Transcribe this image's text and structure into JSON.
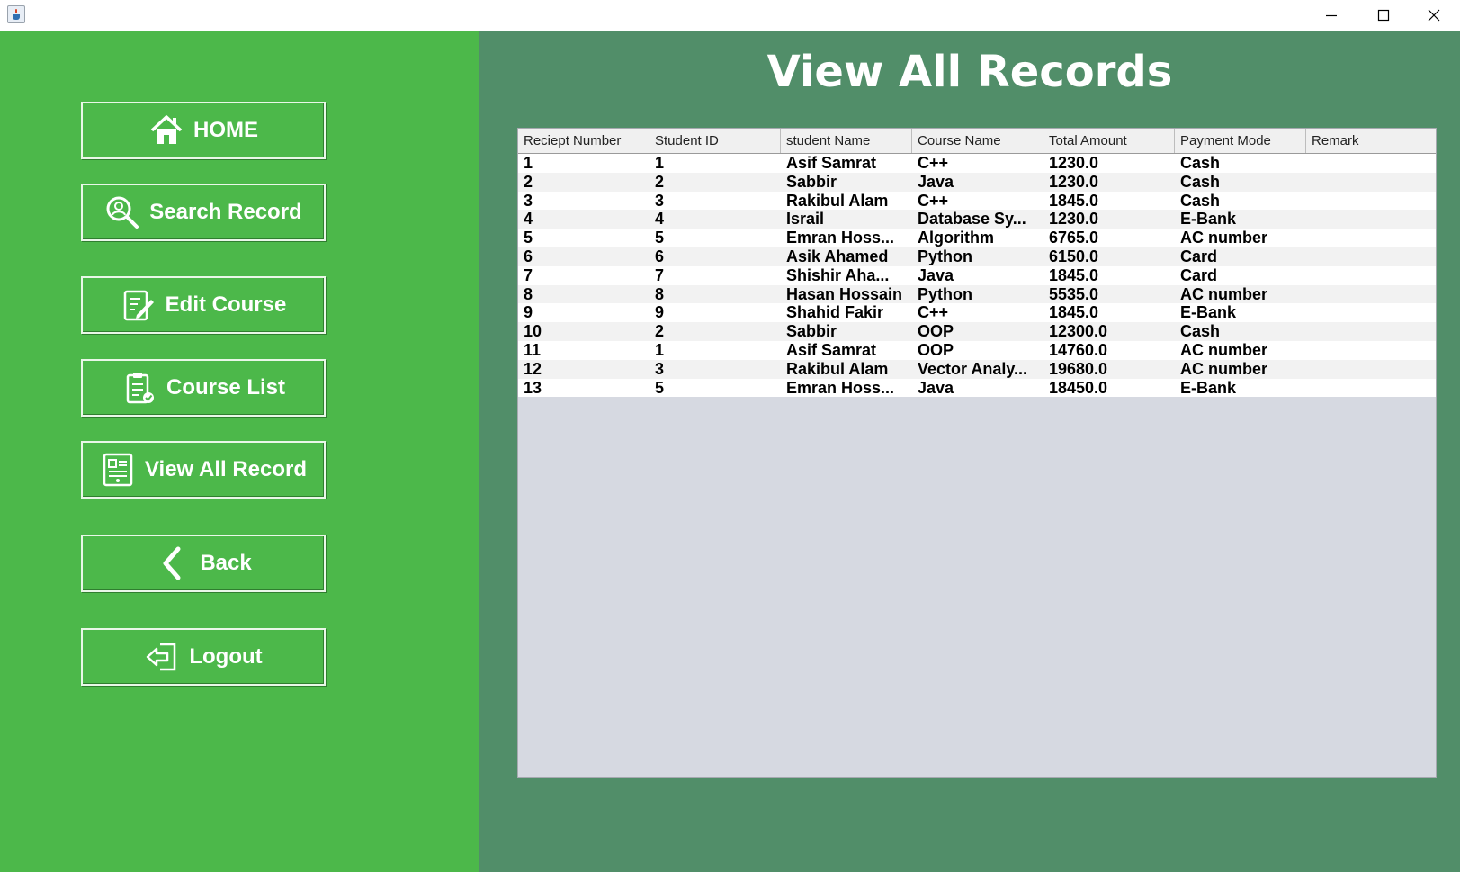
{
  "window": {
    "controls": [
      "minimize",
      "maximize",
      "close"
    ]
  },
  "sidebar": {
    "buttons": [
      {
        "label": "HOME",
        "icon": "home-icon"
      },
      {
        "label": "Search Record",
        "icon": "search-user-icon"
      },
      {
        "label": "Edit Course",
        "icon": "edit-document-icon"
      },
      {
        "label": "Course List",
        "icon": "checklist-icon"
      },
      {
        "label": "View All Record",
        "icon": "record-list-icon"
      },
      {
        "label": "Back",
        "icon": "chevron-left-icon"
      },
      {
        "label": "Logout",
        "icon": "logout-icon"
      }
    ]
  },
  "main": {
    "title": "View All Records",
    "table": {
      "columns": [
        "Reciept Number",
        "Student ID",
        "student Name",
        "Course Name",
        "Total Amount",
        "Payment Mode",
        "Remark"
      ],
      "rows": [
        [
          "1",
          "1",
          "Asif Samrat",
          "C++",
          "1230.0",
          "Cash",
          ""
        ],
        [
          "2",
          "2",
          "Sabbir",
          "Java",
          "1230.0",
          "Cash",
          ""
        ],
        [
          "3",
          "3",
          "Rakibul Alam",
          "C++",
          "1845.0",
          "Cash",
          ""
        ],
        [
          "4",
          "4",
          "Israil",
          "Database Sy...",
          "1230.0",
          "E-Bank",
          ""
        ],
        [
          "5",
          "5",
          "Emran Hoss...",
          "Algorithm",
          "6765.0",
          "AC number",
          ""
        ],
        [
          "6",
          "6",
          "Asik Ahamed",
          "Python",
          "6150.0",
          "Card",
          ""
        ],
        [
          "7",
          "7",
          "Shishir Aha...",
          "Java",
          "1845.0",
          "Card",
          ""
        ],
        [
          "8",
          "8",
          "Hasan Hossain",
          "Python",
          "5535.0",
          "AC number",
          ""
        ],
        [
          "9",
          "9",
          "Shahid Fakir",
          "C++",
          "1845.0",
          "E-Bank",
          ""
        ],
        [
          "10",
          "2",
          "Sabbir",
          "OOP",
          "12300.0",
          "Cash",
          ""
        ],
        [
          "11",
          "1",
          "Asif Samrat",
          "OOP",
          "14760.0",
          "AC number",
          ""
        ],
        [
          "12",
          "3",
          "Rakibul Alam",
          "Vector Analy...",
          "19680.0",
          "AC number",
          ""
        ],
        [
          "13",
          "5",
          "Emran Hoss...",
          "Java",
          "18450.0",
          "E-Bank",
          ""
        ]
      ]
    }
  },
  "colors": {
    "sidebar_bg": "#4cb84a",
    "main_bg": "#518e69",
    "table_empty_bg": "#d6d9e1"
  }
}
